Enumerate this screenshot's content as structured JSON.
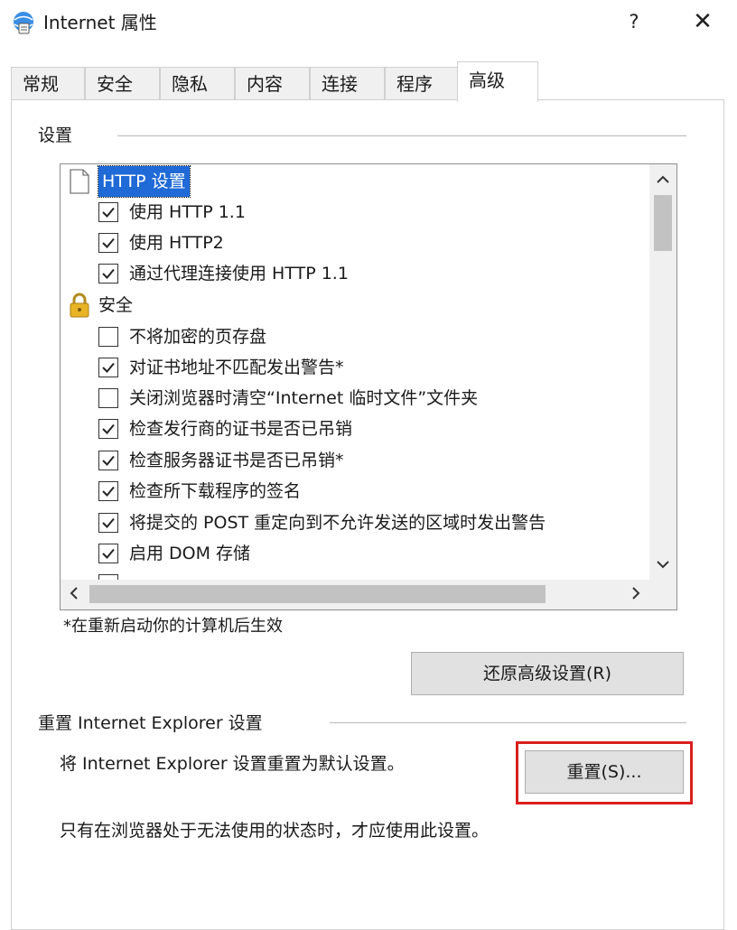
{
  "window": {
    "title": "Internet 属性",
    "help": "?",
    "close": "✕"
  },
  "tabs": [
    {
      "label": "常规"
    },
    {
      "label": "安全"
    },
    {
      "label": "隐私"
    },
    {
      "label": "内容"
    },
    {
      "label": "连接"
    },
    {
      "label": "程序"
    },
    {
      "label": "高级"
    }
  ],
  "active_tab": "高级",
  "settings": {
    "group_label": "设置",
    "items": [
      {
        "type": "category",
        "icon": "document-icon",
        "text": "HTTP 设置",
        "selected": true
      },
      {
        "type": "checkbox",
        "text": "使用 HTTP 1.1",
        "checked": true
      },
      {
        "type": "checkbox",
        "text": "使用 HTTP2",
        "checked": true
      },
      {
        "type": "checkbox",
        "text": "通过代理连接使用 HTTP 1.1",
        "checked": true
      },
      {
        "type": "category",
        "icon": "lock-icon",
        "text": "安全",
        "selected": false
      },
      {
        "type": "checkbox",
        "text": "不将加密的页存盘",
        "checked": false
      },
      {
        "type": "checkbox",
        "text": "对证书地址不匹配发出警告*",
        "checked": true
      },
      {
        "type": "checkbox",
        "text": "关闭浏览器时清空“Internet 临时文件”文件夹",
        "checked": false
      },
      {
        "type": "checkbox",
        "text": "检查发行商的证书是否已吊销",
        "checked": true
      },
      {
        "type": "checkbox",
        "text": "检查服务器证书是否已吊销*",
        "checked": true
      },
      {
        "type": "checkbox",
        "text": "检查所下载程序的签名",
        "checked": true
      },
      {
        "type": "checkbox",
        "text": "将提交的 POST 重定向到不允许发送的区域时发出警告",
        "checked": true
      },
      {
        "type": "checkbox",
        "text": "启用 DOM 存储",
        "checked": true
      }
    ],
    "note": "*在重新启动你的计算机后生效",
    "restore_button": "还原高级设置(R)"
  },
  "reset_section": {
    "group_label": "重置 Internet Explorer 设置",
    "description": "将 Internet Explorer 设置重置为默认设置。",
    "reset_button": "重置(S)...",
    "warning": "只有在浏览器处于无法使用的状态时，才应使用此设置。"
  },
  "colors": {
    "selection": "#1f6ad7",
    "highlight_box": "#d9201e",
    "button_face": "#e1e1e1"
  }
}
